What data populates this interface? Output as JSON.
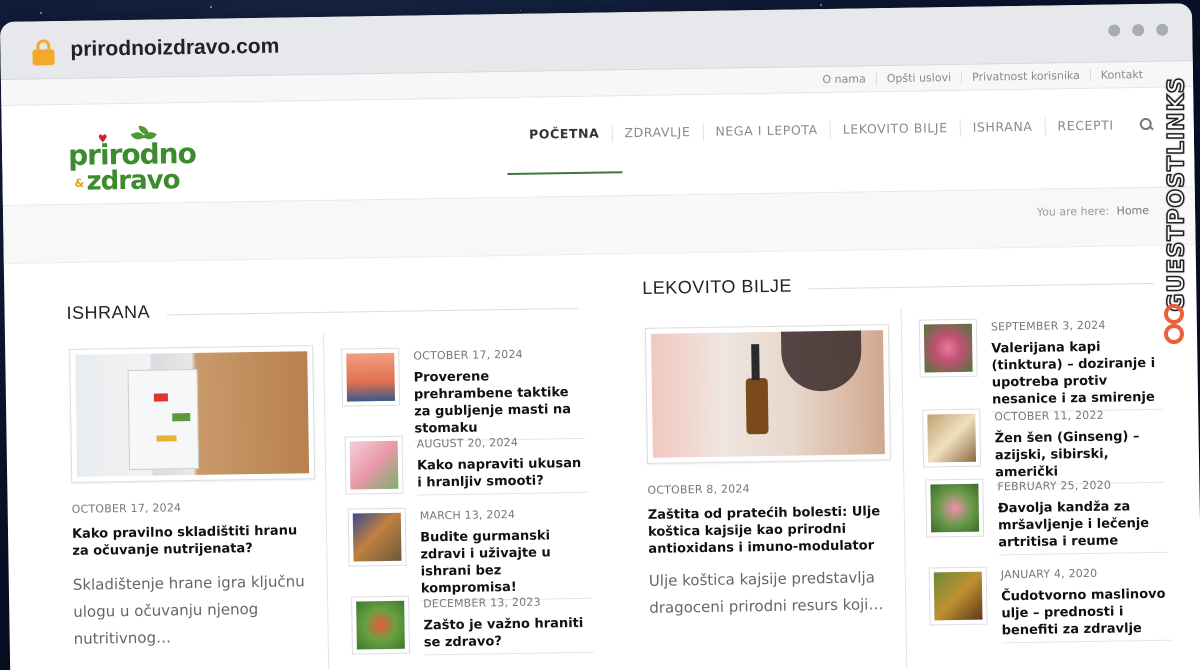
{
  "browser": {
    "url": "prirodnoizdravo.com"
  },
  "topbar": {
    "links": [
      "O nama",
      "Opšti uslovi",
      "Privatnost korisnika",
      "Kontakt"
    ]
  },
  "logo": {
    "line1": "prirodno",
    "amp": "&",
    "line2": "zdravo"
  },
  "nav": {
    "items": [
      "POČETNA",
      "ZDRAVLJE",
      "NEGA I LEPOTA",
      "LEKOVITO BILJE",
      "ISHRANA",
      "RECEPTI"
    ]
  },
  "breadcrumb": {
    "prefix": "You are here:",
    "home": "Home"
  },
  "sections": {
    "ishrana": {
      "title": "ISHRANA",
      "featured": {
        "date": "OCTOBER 17, 2024",
        "title": "Kako pravilno skladištiti hranu za očuvanje nutrijenata?",
        "excerpt": "Skladištenje hrane igra ključnu ulogu u očuvanju njenog nutritivnog…"
      },
      "items": [
        {
          "date": "OCTOBER 17, 2024",
          "title": "Proverene prehrambene taktike za gubljenje masti na stomaku"
        },
        {
          "date": "AUGUST 20, 2024",
          "title": "Kako napraviti ukusan i hranljiv smooti?"
        },
        {
          "date": "MARCH 13, 2024",
          "title": "Budite gurmanski zdravi i uživajte u ishrani bez kompromisa!"
        },
        {
          "date": "DECEMBER 13, 2023",
          "title": "Zašto je važno hraniti se zdravo?"
        }
      ]
    },
    "lekovito": {
      "title": "LEKOVITO BILJE",
      "featured": {
        "date": "OCTOBER 8, 2024",
        "title": "Zaštita od pratećih bolesti: Ulje koštica kajsije kao prirodni antioxidans i imuno-modulator",
        "excerpt": "Ulje koštica kajsije predstavlja dragoceni prirodni resurs koji…"
      },
      "items": [
        {
          "date": "SEPTEMBER 3, 2024",
          "title": "Valerijana kapi (tinktura) – doziranje i upotreba protiv nesanice i za smirenje"
        },
        {
          "date": "OCTOBER 11, 2022",
          "title": "Žen šen (Ginseng) – azijski, sibirski, američki"
        },
        {
          "date": "FEBRUARY 25, 2020",
          "title": "Đavolja kandža za mršavljenje i lečenje artritisa i reume"
        },
        {
          "date": "JANUARY 4, 2020",
          "title": "Čudotvorno maslinovo ulje – prednosti i benefiti za zdravlje"
        }
      ]
    }
  },
  "watermark": {
    "text": "GUESTPOSTLINKS"
  }
}
